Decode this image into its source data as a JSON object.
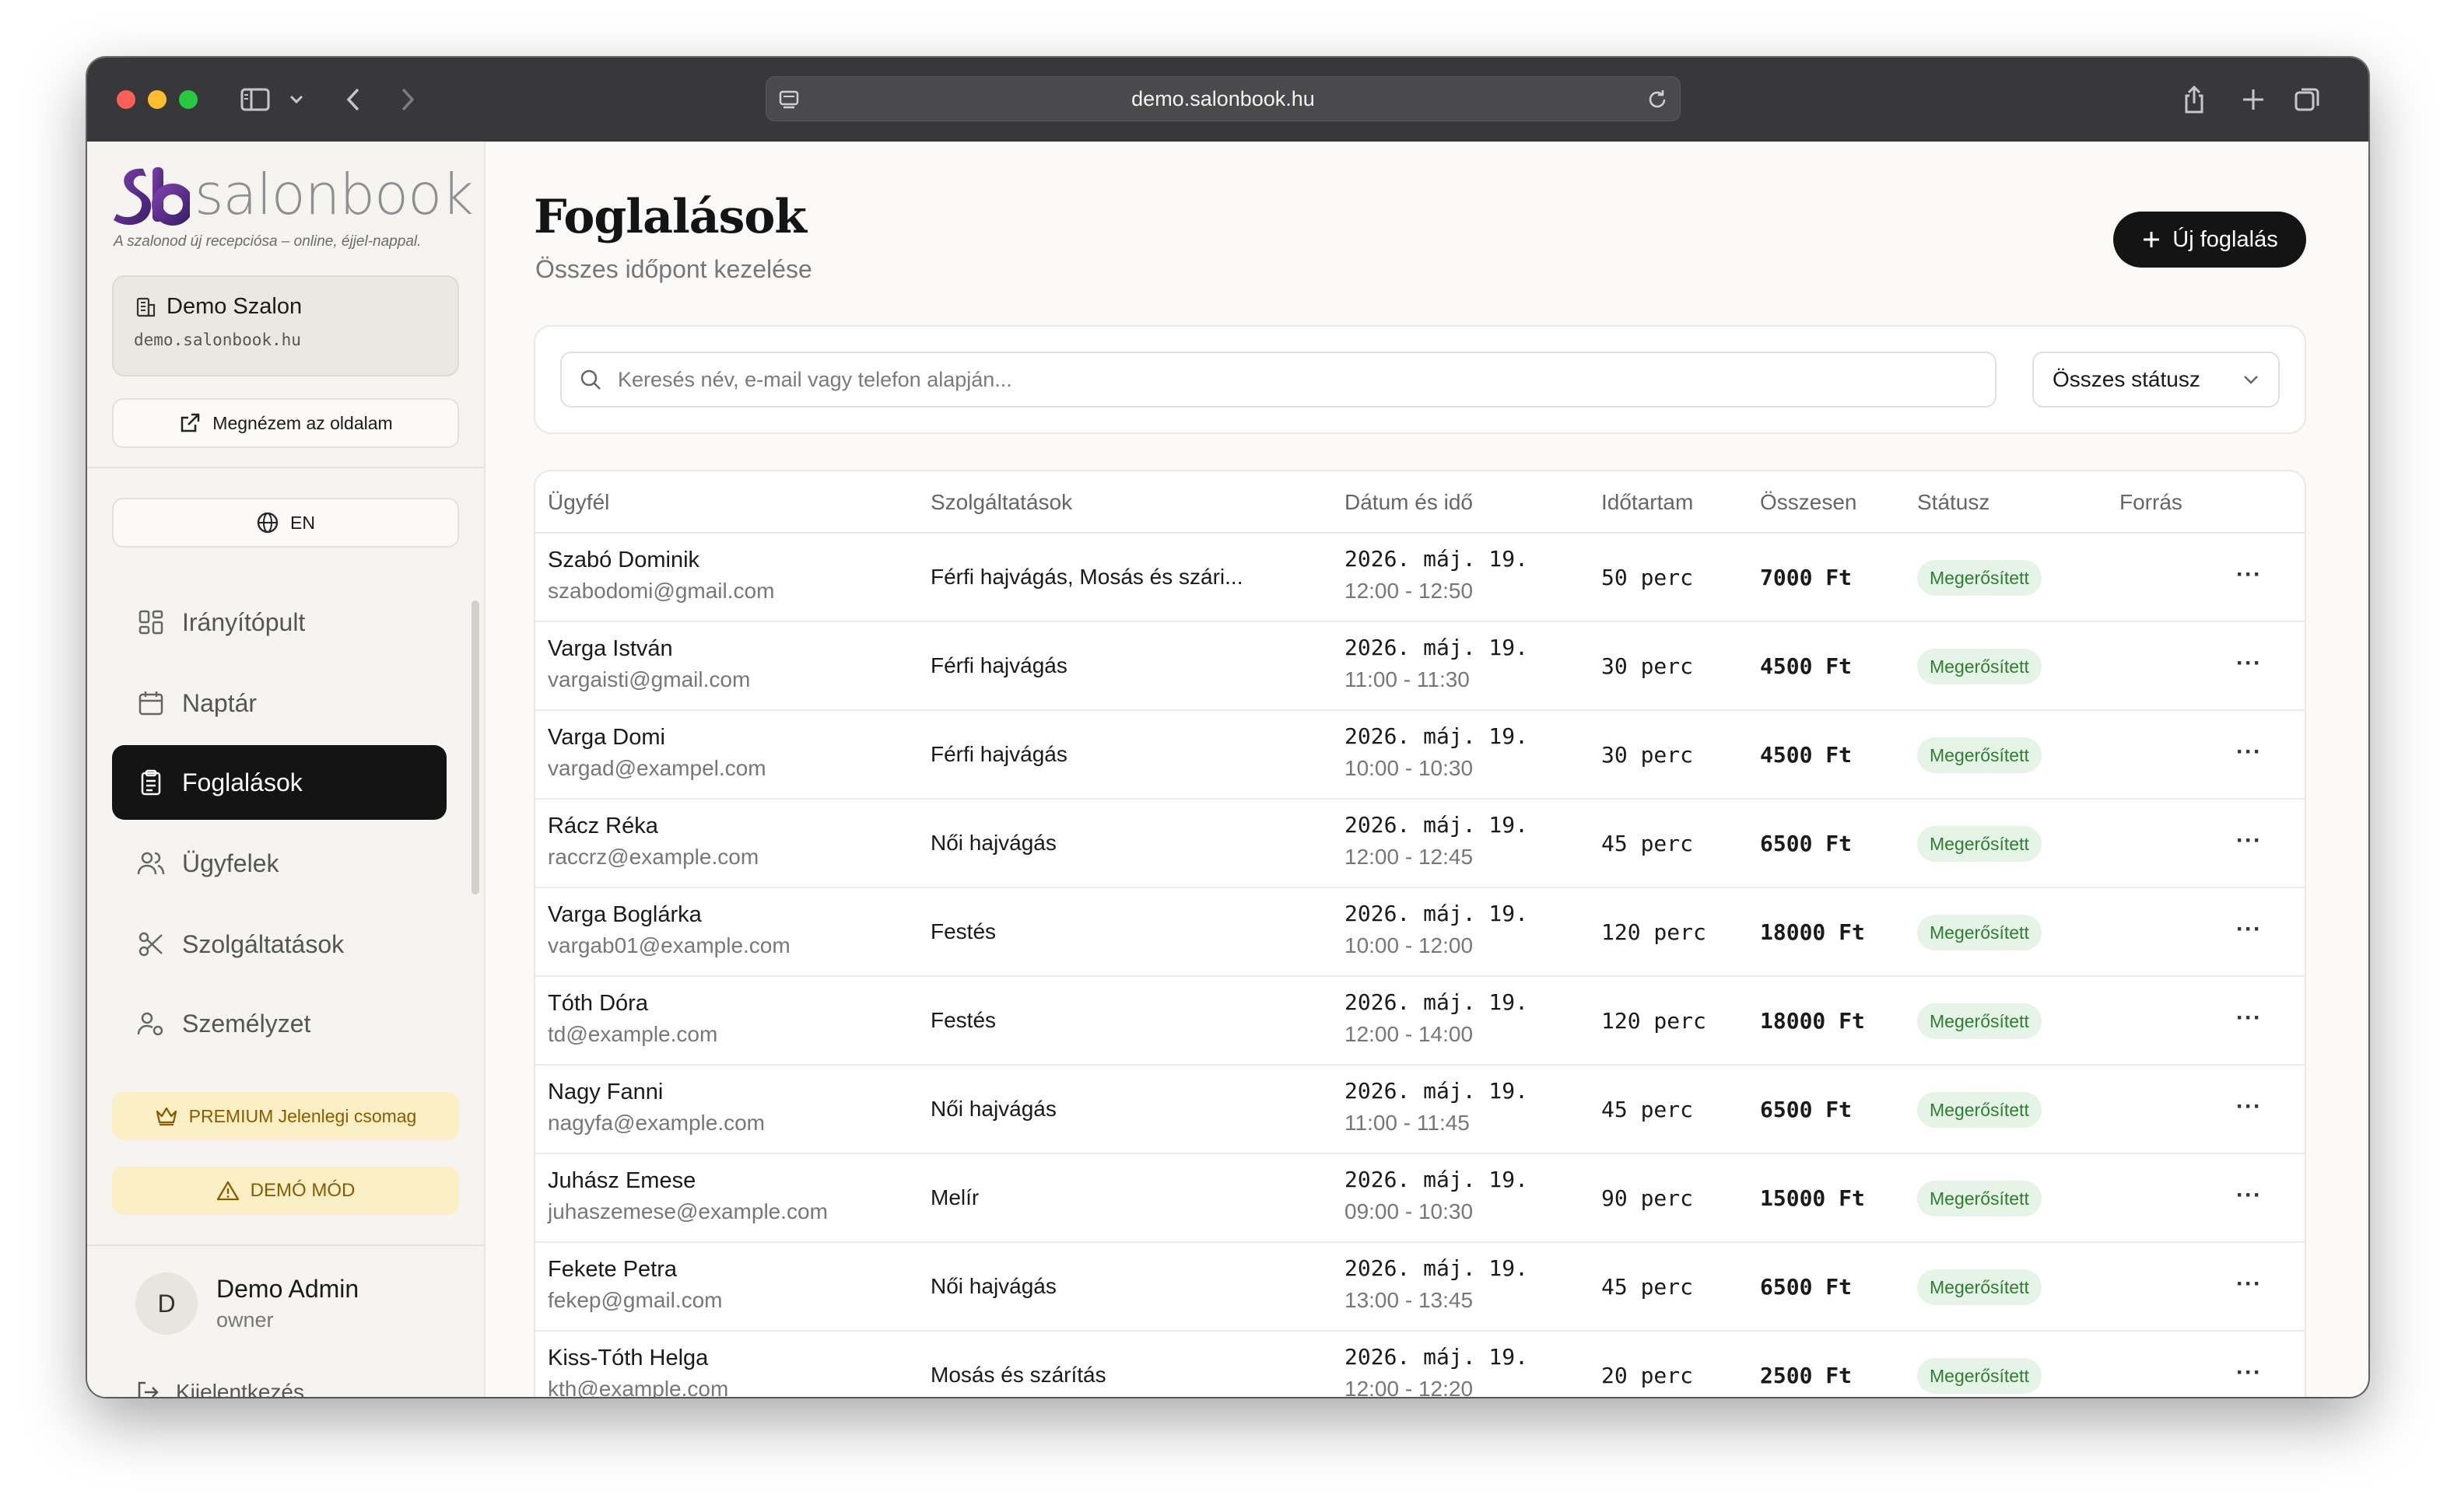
{
  "browser": {
    "url": "demo.salonbook.hu"
  },
  "sidebar": {
    "logo_text": "salonbook",
    "tagline": "A szalonod új recepciósa – online, éjjel-nappal.",
    "salon_name": "Demo Szalon",
    "salon_domain": "demo.salonbook.hu",
    "view_site_label": "Megnézem az oldalam",
    "language_label": "EN",
    "nav": [
      {
        "label": "Irányítópult",
        "icon": "dashboard-icon"
      },
      {
        "label": "Naptár",
        "icon": "calendar-icon"
      },
      {
        "label": "Foglalások",
        "icon": "clipboard-icon",
        "active": true
      },
      {
        "label": "Ügyfelek",
        "icon": "users-icon"
      },
      {
        "label": "Szolgáltatások",
        "icon": "scissors-icon"
      },
      {
        "label": "Személyzet",
        "icon": "staff-icon"
      }
    ],
    "premium_label": "PREMIUM Jelenlegi csomag",
    "demo_label": "DEMÓ MÓD",
    "user": {
      "initial": "D",
      "name": "Demo Admin",
      "role": "owner"
    },
    "logout_label": "Kijelentkezés"
  },
  "main": {
    "title": "Foglalások",
    "subtitle": "Összes időpont kezelése",
    "new_button_label": "Új foglalás",
    "search_placeholder": "Keresés név, e-mail vagy telefon alapján...",
    "status_filter": "Összes státusz",
    "columns": [
      "Ügyfél",
      "Szolgáltatások",
      "Dátum és idő",
      "Időtartam",
      "Összesen",
      "Státusz",
      "Forrás"
    ],
    "rows": [
      {
        "name": "Szabó Dominik",
        "email": "szabodomi@gmail.com",
        "service": "Férfi hajvágás, Mosás és szári...",
        "date": "2026. máj. 19.",
        "time": "12:00 - 12:50",
        "duration": "50 perc",
        "total": "7000 Ft",
        "status": "Megerősített",
        "more": "···"
      },
      {
        "name": "Varga István",
        "email": "vargaisti@gmail.com",
        "service": "Férfi hajvágás",
        "date": "2026. máj. 19.",
        "time": "11:00 - 11:30",
        "duration": "30 perc",
        "total": "4500 Ft",
        "status": "Megerősített",
        "more": "···"
      },
      {
        "name": "Varga Domi",
        "email": "vargad@exampel.com",
        "service": "Férfi hajvágás",
        "date": "2026. máj. 19.",
        "time": "10:00 - 10:30",
        "duration": "30 perc",
        "total": "4500 Ft",
        "status": "Megerősített",
        "more": "···"
      },
      {
        "name": "Rácz Réka",
        "email": "raccrz@example.com",
        "service": "Női hajvágás",
        "date": "2026. máj. 19.",
        "time": "12:00 - 12:45",
        "duration": "45 perc",
        "total": "6500 Ft",
        "status": "Megerősített",
        "more": "···"
      },
      {
        "name": "Varga Boglárka",
        "email": "vargab01@example.com",
        "service": "Festés",
        "date": "2026. máj. 19.",
        "time": "10:00 - 12:00",
        "duration": "120 perc",
        "total": "18000 Ft",
        "status": "Megerősített",
        "more": "···"
      },
      {
        "name": "Tóth Dóra",
        "email": "td@example.com",
        "service": "Festés",
        "date": "2026. máj. 19.",
        "time": "12:00 - 14:00",
        "duration": "120 perc",
        "total": "18000 Ft",
        "status": "Megerősített",
        "more": "···"
      },
      {
        "name": "Nagy Fanni",
        "email": "nagyfa@example.com",
        "service": "Női hajvágás",
        "date": "2026. máj. 19.",
        "time": "11:00 - 11:45",
        "duration": "45 perc",
        "total": "6500 Ft",
        "status": "Megerősített",
        "more": "···"
      },
      {
        "name": "Juhász Emese",
        "email": "juhaszemese@example.com",
        "service": "Melír",
        "date": "2026. máj. 19.",
        "time": "09:00 - 10:30",
        "duration": "90 perc",
        "total": "15000 Ft",
        "status": "Megerősített",
        "more": "···"
      },
      {
        "name": "Fekete Petra",
        "email": "fekep@gmail.com",
        "service": "Női hajvágás",
        "date": "2026. máj. 19.",
        "time": "13:00 - 13:45",
        "duration": "45 perc",
        "total": "6500 Ft",
        "status": "Megerősített",
        "more": "···"
      },
      {
        "name": "Kiss-Tóth Helga",
        "email": "kth@example.com",
        "service": "Mosás és szárítás",
        "date": "2026. máj. 19.",
        "time": "12:00 - 12:20",
        "duration": "20 perc",
        "total": "2500 Ft",
        "status": "Megerősített",
        "more": "···"
      }
    ]
  },
  "colors": {
    "accent_dark": "#141414",
    "logo_purple": "#5b2a86",
    "status_green_bg": "#e5f4e6",
    "status_green_text": "#2e7d32",
    "premium_bg": "#fbefc6"
  }
}
